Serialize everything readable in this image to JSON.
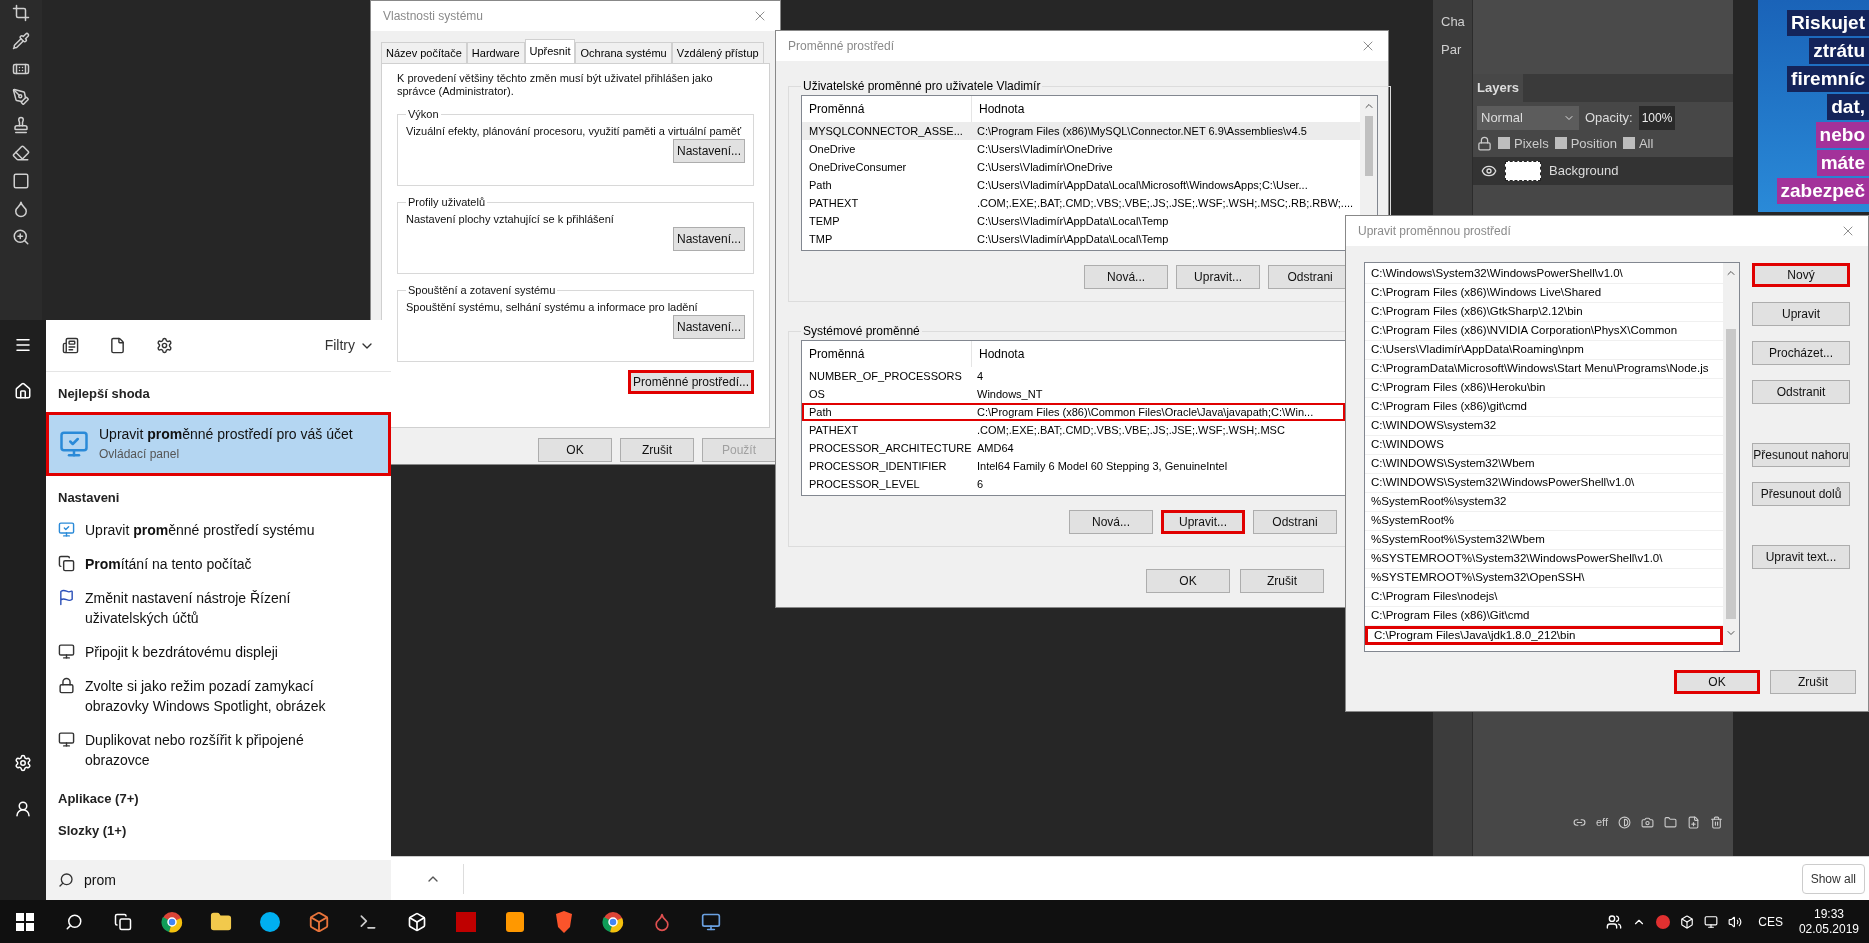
{
  "photoshop": {
    "side_tabs": [
      "Cha",
      "Par"
    ],
    "layers_panel": {
      "title": "Layers",
      "blend_mode": "Normal",
      "opacity_label": "Opacity:",
      "opacity_value": "100%",
      "lock_options": [
        {
          "label": "Pixels",
          "checked": false
        },
        {
          "label": "Position",
          "checked": false
        },
        {
          "label": "All",
          "checked": false
        }
      ],
      "layers": [
        {
          "name": "Background",
          "visible": true
        }
      ],
      "footer_label": "eff"
    }
  },
  "ad": {
    "lines": [
      {
        "text": "Riskujet",
        "color": "#14245a"
      },
      {
        "text": "ztrátu",
        "color": "#14245a"
      },
      {
        "text": "firemníc",
        "color": "#14245a"
      },
      {
        "text": "dat,",
        "color": "#14245a"
      },
      {
        "text": "nebo",
        "color": "#a3329a"
      },
      {
        "text": "máte",
        "color": "#a3329a"
      },
      {
        "text": "zabezpeč",
        "color": "#a3329a"
      }
    ]
  },
  "system_properties": {
    "title": "Vlastnosti systému",
    "tabs": [
      {
        "label": "Název počítače",
        "selected": false
      },
      {
        "label": "Hardware",
        "selected": false
      },
      {
        "label": "Upřesnit",
        "selected": true
      },
      {
        "label": "Ochrana systému",
        "selected": false
      },
      {
        "label": "Vzdálený přístup",
        "selected": false
      }
    ],
    "notice": "K provedení většiny těchto změn musí být uživatel přihlášen jako správce (Administrator).",
    "groups": [
      {
        "title": "Výkon",
        "description": "Vizuální efekty, plánování procesoru, využití paměti a virtuální paměť",
        "button": "Nastavení..."
      },
      {
        "title": "Profily uživatelů",
        "description": "Nastavení plochy vztahující se k přihlášení",
        "button": "Nastavení..."
      },
      {
        "title": "Spouštění a zotavení systému",
        "description": "Spouštění systému, selhání systému a informace pro ladění",
        "button": "Nastavení..."
      }
    ],
    "env_button": {
      "label": "Proměnné prostředí...",
      "highlighted": true
    },
    "buttons": [
      {
        "label": "OK",
        "disabled": false
      },
      {
        "label": "Zrušit",
        "disabled": false
      },
      {
        "label": "Použít",
        "disabled": true
      }
    ]
  },
  "environment_variables": {
    "title": "Proměnné prostředí",
    "sections": [
      {
        "title": "Uživatelské proměnné pro uživatele Vladimír",
        "columns": [
          "Proměnná",
          "Hodnota"
        ],
        "rows": [
          {
            "name": "MYSQLCONNECTOR_ASSE...",
            "value": "C:\\Program Files (x86)\\MySQL\\Connector.NET 6.9\\Assemblies\\v4.5",
            "selected": true,
            "highlighted": false
          },
          {
            "name": "OneDrive",
            "value": "C:\\Users\\Vladimír\\OneDrive",
            "selected": false,
            "highlighted": false
          },
          {
            "name": "OneDriveConsumer",
            "value": "C:\\Users\\Vladimír\\OneDrive",
            "selected": false,
            "highlighted": false
          },
          {
            "name": "Path",
            "value": "C:\\Users\\Vladimír\\AppData\\Local\\Microsoft\\WindowsApps;C:\\User...",
            "selected": false,
            "highlighted": false
          },
          {
            "name": "PATHEXT",
            "value": ".COM;.EXE;.BAT;.CMD;.VBS;.VBE;.JS;.JSE;.WSF;.WSH;.MSC;.RB;.RBW;....",
            "selected": false,
            "highlighted": false
          },
          {
            "name": "TEMP",
            "value": "C:\\Users\\Vladimír\\AppData\\Local\\Temp",
            "selected": false,
            "highlighted": false
          },
          {
            "name": "TMP",
            "value": "C:\\Users\\Vladimír\\AppData\\Local\\Temp",
            "selected": false,
            "highlighted": false
          }
        ],
        "buttons": [
          {
            "label": "Nová...",
            "highlighted": false
          },
          {
            "label": "Upravit...",
            "highlighted": false
          },
          {
            "label": "Odstrani",
            "highlighted": false
          }
        ]
      },
      {
        "title": "Systémové proměnné",
        "columns": [
          "Proměnná",
          "Hodnota"
        ],
        "rows": [
          {
            "name": "NUMBER_OF_PROCESSORS",
            "value": "4",
            "selected": false,
            "highlighted": false
          },
          {
            "name": "OS",
            "value": "Windows_NT",
            "selected": false,
            "highlighted": false
          },
          {
            "name": "Path",
            "value": "C:\\Program Files (x86)\\Common Files\\Oracle\\Java\\javapath;C:\\Win...",
            "selected": false,
            "highlighted": true
          },
          {
            "name": "PATHEXT",
            "value": ".COM;.EXE;.BAT;.CMD;.VBS;.VBE;.JS;.JSE;.WSF;.WSH;.MSC",
            "selected": false,
            "highlighted": false
          },
          {
            "name": "PROCESSOR_ARCHITECTURE",
            "value": "AMD64",
            "selected": false,
            "highlighted": false
          },
          {
            "name": "PROCESSOR_IDENTIFIER",
            "value": "Intel64 Family 6 Model 60 Stepping 3, GenuineIntel",
            "selected": false,
            "highlighted": false
          },
          {
            "name": "PROCESSOR_LEVEL",
            "value": "6",
            "selected": false,
            "highlighted": false
          }
        ],
        "buttons": [
          {
            "label": "Nová...",
            "highlighted": false
          },
          {
            "label": "Upravit...",
            "highlighted": true
          },
          {
            "label": "Odstrani",
            "highlighted": false
          }
        ]
      }
    ],
    "buttons": [
      {
        "label": "OK",
        "highlighted": false
      },
      {
        "label": "Zrušit",
        "highlighted": false
      }
    ]
  },
  "edit_variable": {
    "title": "Upravit proměnnou prostředí",
    "entries": [
      {
        "text": "C:\\Windows\\System32\\WindowsPowerShell\\v1.0\\",
        "highlighted": false
      },
      {
        "text": "C:\\Program Files (x86)\\Windows Live\\Shared",
        "highlighted": false
      },
      {
        "text": "C:\\Program Files (x86)\\GtkSharp\\2.12\\bin",
        "highlighted": false
      },
      {
        "text": "C:\\Program Files (x86)\\NVIDIA Corporation\\PhysX\\Common",
        "highlighted": false
      },
      {
        "text": "C:\\Users\\Vladimír\\AppData\\Roaming\\npm",
        "highlighted": false
      },
      {
        "text": "C:\\ProgramData\\Microsoft\\Windows\\Start Menu\\Programs\\Node.js",
        "highlighted": false
      },
      {
        "text": "C:\\Program Files (x86)\\Heroku\\bin",
        "highlighted": false
      },
      {
        "text": "C:\\Program Files (x86)\\git\\cmd",
        "highlighted": false
      },
      {
        "text": "C:\\WINDOWS\\system32",
        "highlighted": false
      },
      {
        "text": "C:\\WINDOWS",
        "highlighted": false
      },
      {
        "text": "C:\\WINDOWS\\System32\\Wbem",
        "highlighted": false
      },
      {
        "text": "C:\\WINDOWS\\System32\\WindowsPowerShell\\v1.0\\",
        "highlighted": false
      },
      {
        "text": "%SystemRoot%\\system32",
        "highlighted": false
      },
      {
        "text": "%SystemRoot%",
        "highlighted": false
      },
      {
        "text": "%SystemRoot%\\System32\\Wbem",
        "highlighted": false
      },
      {
        "text": "%SYSTEMROOT%\\System32\\WindowsPowerShell\\v1.0\\",
        "highlighted": false
      },
      {
        "text": "%SYSTEMROOT%\\System32\\OpenSSH\\",
        "highlighted": false
      },
      {
        "text": "C:\\Program Files\\nodejs\\",
        "highlighted": false
      },
      {
        "text": "C:\\Program Files (x86)\\Git\\cmd",
        "highlighted": false
      },
      {
        "text": "C:\\Program Files\\Java\\jdk1.8.0_212\\bin",
        "highlighted": true
      }
    ],
    "side_buttons": [
      {
        "label": "Nový",
        "highlighted": true
      },
      {
        "label": "Upravit",
        "highlighted": false
      },
      {
        "label": "Procházet...",
        "highlighted": false
      },
      {
        "label": "Odstranit",
        "highlighted": false
      },
      {
        "label": "Přesunout nahoru",
        "highlighted": false
      },
      {
        "label": "Přesunout dolů",
        "highlighted": false
      },
      {
        "label": "Upravit text...",
        "highlighted": false
      }
    ],
    "buttons": [
      {
        "label": "OK",
        "highlighted": true
      },
      {
        "label": "Zrušit",
        "highlighted": false
      }
    ]
  },
  "start_menu": {
    "filter_label": "Filtry",
    "best_match": {
      "heading": "Nejlepší shoda",
      "title": "Upravit **prom**ěnné prostředí pro váš účet",
      "subtitle": "Ovládací panel",
      "selected": true,
      "highlighted": true
    },
    "settings": {
      "heading": "Nastaveni",
      "items": [
        {
          "kind": "display",
          "text": "Upravit **prom**ěnné prostředí systému"
        },
        {
          "kind": "projection",
          "text": "**Prom**ítání na tento počítač"
        },
        {
          "kind": "flag",
          "text": "Změnit nastavení nástroje Řízení uživatelských účtů"
        },
        {
          "kind": "monitor",
          "text": "Připojit k bezdrátovému displeji"
        },
        {
          "kind": "lockscreen",
          "text": "Zvolte si jako režim pozadí zamykací obrazovky Windows Spotlight, obrázek"
        },
        {
          "kind": "monitor",
          "text": "Duplikovat nebo rozšířit k připojené obrazovce"
        }
      ]
    },
    "categories": [
      "Aplikace (7+)",
      "Slozky (1+)"
    ],
    "search_value": "prom"
  },
  "download_bar": {
    "show_all": "Show all"
  },
  "taskbar": {
    "language": "CES",
    "time": "19:33",
    "date": "02.05.2019"
  }
}
